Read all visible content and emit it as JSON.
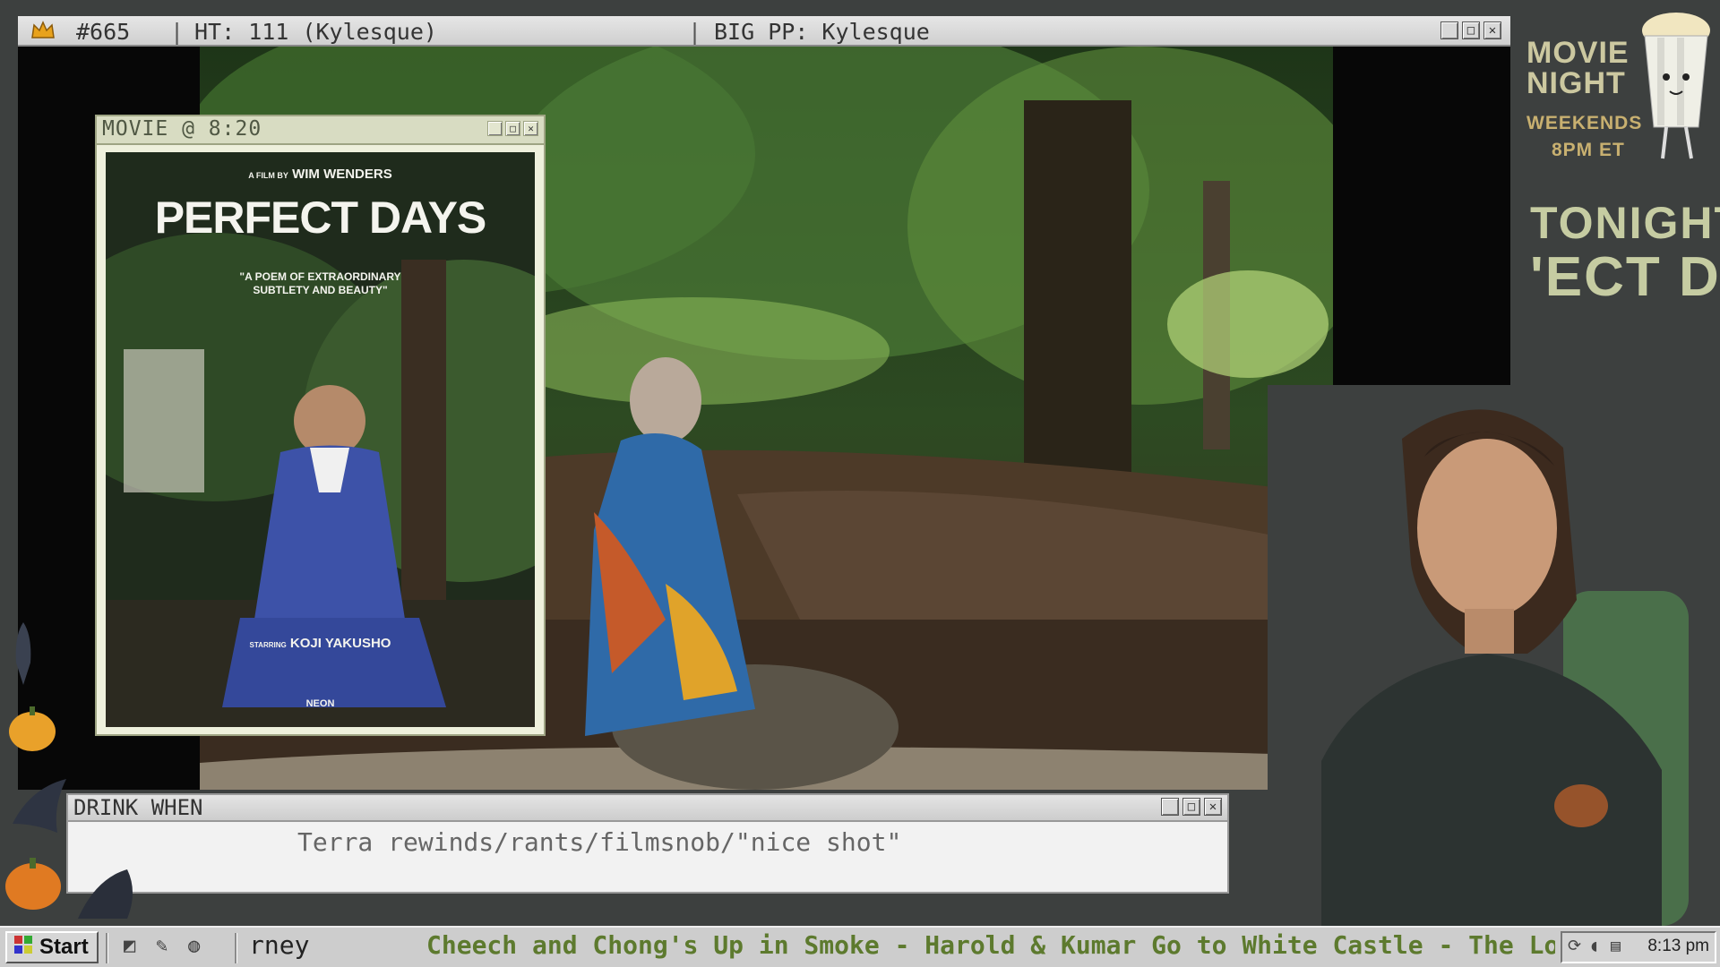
{
  "top_bar": {
    "count": "#665",
    "ht": "HT: 111 (Kylesque)",
    "big_pp": "BIG PP: Kylesque"
  },
  "poster_window": {
    "title": "MOVIE @ 8:20",
    "poster": {
      "director_prefix": "A FILM BY",
      "director": "WIM WENDERS",
      "movie_title": "PERFECT DAYS",
      "quote_line1": "\"A POEM OF EXTRAORDINARY",
      "quote_line2": "SUBTLETY AND BEAUTY\"",
      "starring_prefix": "STARRING",
      "star": "KOJI YAKUSHO",
      "distributor": "NEON"
    }
  },
  "drink_window": {
    "title": "DRINK WHEN",
    "text": "Terra rewinds/rants/filmsnob/\"nice shot\""
  },
  "taskbar": {
    "start_label": "Start",
    "task_button": "rney",
    "ticker": "Cheech and Chong's Up in Smoke - Harold & Kumar Go to White Castle - The Lon",
    "clock": "8:13 pm"
  },
  "sidebar": {
    "movie": "MOVIE",
    "night": "NIGHT",
    "weekends": "WEEKENDS",
    "time": "8PM ET",
    "tonight": "TONIGHT:",
    "tonight_title": "'ECT DAY"
  },
  "colors": {
    "accent_green": "#5d7a2e",
    "sidebar_text": "#c6cca2",
    "background": "#3d403f"
  },
  "icons": [
    "crown-icon",
    "minimize-icon",
    "maximize-icon",
    "close-icon",
    "start-logo-icon",
    "popcorn-icon",
    "pumpkin-icon",
    "crow-icon"
  ]
}
